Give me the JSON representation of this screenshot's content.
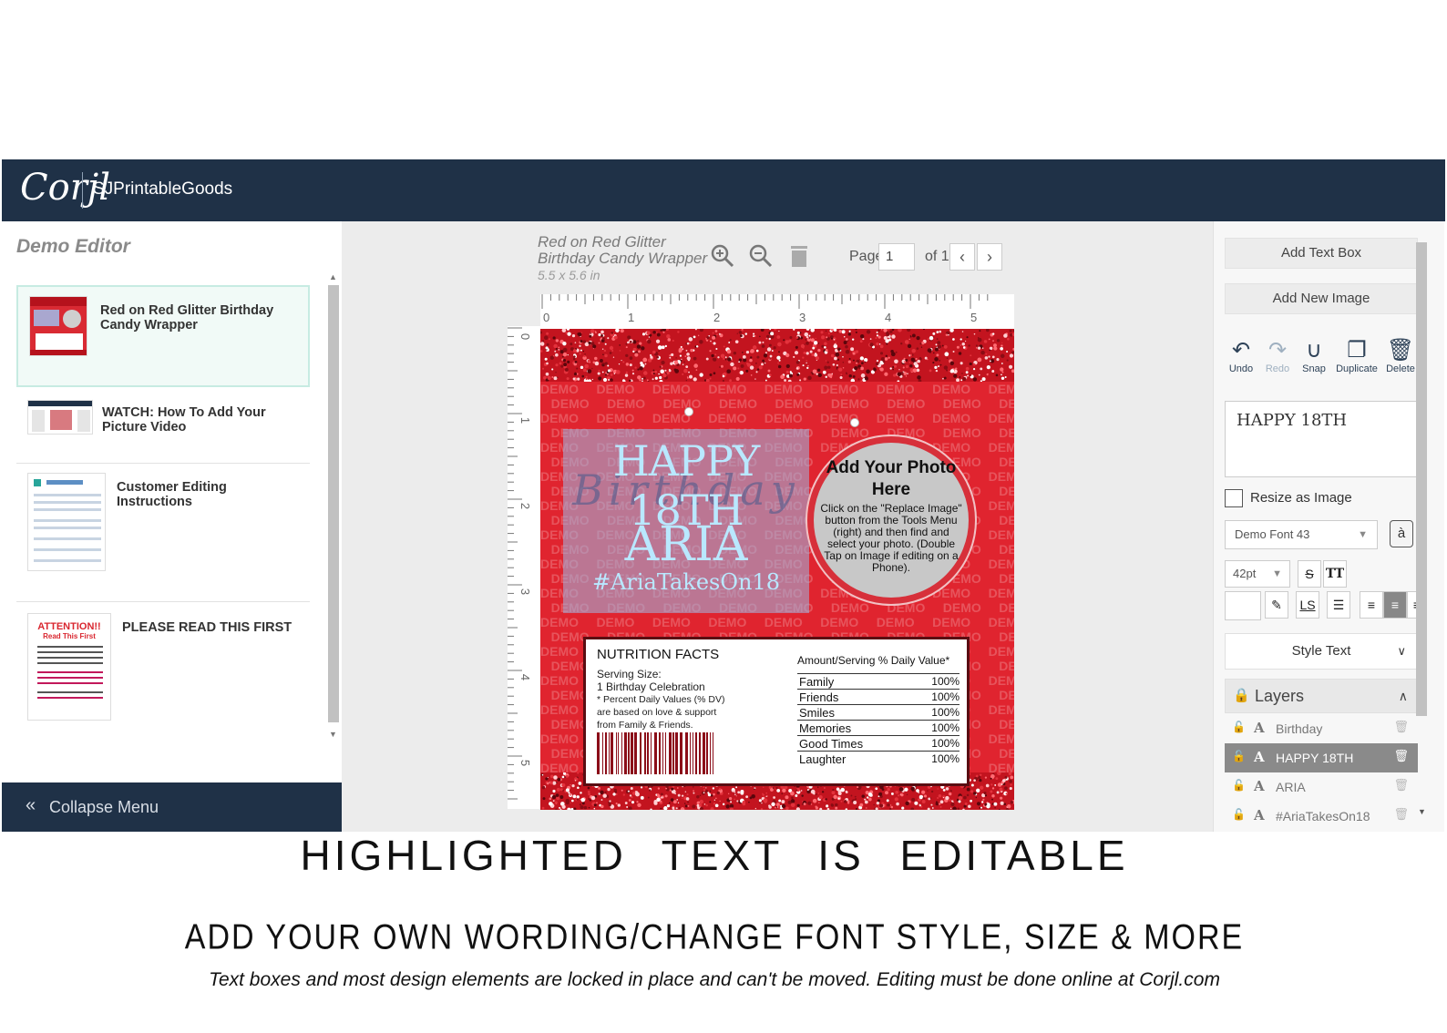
{
  "header": {
    "logo": "Corjl",
    "shop_name": "SJPrintableGoods"
  },
  "left_panel": {
    "title": "Demo Editor",
    "templates": [
      {
        "label": "Red on Red Glitter Birthday Candy Wrapper",
        "selected": true
      },
      {
        "label": "WATCH: How To Add Your Picture Video",
        "selected": false
      },
      {
        "label": "Customer Editing Instructions",
        "selected": false
      },
      {
        "label": "PLEASE READ THIS FIRST",
        "selected": false
      }
    ],
    "attention_thumb": {
      "title": "ATTENTION!!",
      "subtitle": "Read This First"
    },
    "collapse_label": "Collapse Menu"
  },
  "canvas": {
    "doc_title": "Red on Red Glitter Birthday Candy Wrapper",
    "doc_size": "5.5 x 5.6 in",
    "page_label": "Page",
    "page_value": "1",
    "page_of": "of 1",
    "ruler_top": [
      "0",
      "1",
      "2",
      "3",
      "4",
      "5"
    ],
    "ruler_left": [
      "0",
      "1",
      "2",
      "3",
      "4",
      "5"
    ]
  },
  "design": {
    "happy_text": "HAPPY 18TH",
    "birthday_script": "Birthday",
    "name_text": "ARIA",
    "hashtag": "#AriaTakesOn18",
    "photo_title": "Add Your Photo Here",
    "photo_body": "Click on the \"Replace Image\" button from the Tools Menu (right) and then find and select your photo. (Double Tap on Image if editing on a Phone).",
    "watermark_word": "DEMO",
    "nutrition": {
      "title": "NUTRITION FACTS",
      "serving_label": "Serving Size:",
      "serving_value": "1 Birthday Celebration",
      "dv_note": "* Percent Daily Values (% DV)",
      "dv_note2": "are based on love & support",
      "dv_note3": "from Family & Friends.",
      "table_head": "Amount/Serving % Daily Value*",
      "rows": [
        {
          "k": "Family",
          "v": "100%"
        },
        {
          "k": "Friends",
          "v": "100%"
        },
        {
          "k": "Smiles",
          "v": "100%"
        },
        {
          "k": "Memories",
          "v": "100%"
        },
        {
          "k": "Good Times",
          "v": "100%"
        },
        {
          "k": "Laughter",
          "v": "100%"
        }
      ]
    }
  },
  "right_panel": {
    "add_text_box": "Add Text Box",
    "add_new_image": "Add New Image",
    "tools": [
      {
        "icon": "undo-icon",
        "label": "Undo"
      },
      {
        "icon": "redo-icon",
        "label": "Redo"
      },
      {
        "icon": "magnet-icon",
        "label": "Snap"
      },
      {
        "icon": "duplicate-icon",
        "label": "Duplicate"
      },
      {
        "icon": "trash-icon",
        "label": "Delete"
      }
    ],
    "text_value": "HAPPY 18TH",
    "resize_label": "Resize as Image",
    "font_value": "Demo Font 43",
    "glyph_label": "à",
    "size_value": "42pt",
    "format": {
      "strike": "S",
      "caps": "TT",
      "letter_spacing": "LS"
    },
    "style_text_label": "Style Text",
    "layers_label": "Layers",
    "layers": [
      {
        "name": "Birthday",
        "selected": false
      },
      {
        "name": "HAPPY 18TH",
        "selected": true
      },
      {
        "name": "ARIA",
        "selected": false
      },
      {
        "name": "#AriaTakesOn18",
        "selected": false
      }
    ]
  },
  "captions": {
    "main": "HIGHLIGHTED TEXT IS EDITABLE",
    "sub": "ADD YOUR OWN WORDING/CHANGE FONT STYLE, SIZE & MORE",
    "note": "Text boxes and most design elements are locked in place and can't be moved. Editing must be done online at Corjl.com"
  },
  "colors": {
    "header_bg": "#1f3147",
    "wrapper_red": "#e0242f",
    "text_blue": "#b9e8ff",
    "panel_bg": "#f7f7f7",
    "canvas_bg": "#ececec"
  }
}
